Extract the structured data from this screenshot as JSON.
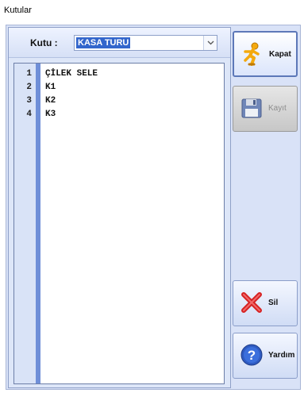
{
  "window": {
    "title": "Kutular"
  },
  "selector": {
    "label": "Kutu :",
    "value": "KASA TURU"
  },
  "editor": {
    "lines": [
      {
        "num": "1",
        "text": "ÇİLEK SELE"
      },
      {
        "num": "2",
        "text": "K1"
      },
      {
        "num": "3",
        "text": "K2"
      },
      {
        "num": "4",
        "text": "K3"
      }
    ]
  },
  "buttons": {
    "kapat": "Kapat",
    "kaydet": "Kayıt",
    "sil": "Sil",
    "yardim": "Yardım"
  },
  "colors": {
    "selection": "#3366cc",
    "panel": "#d9e2f7",
    "gutter_bar": "#6f8fd8"
  }
}
